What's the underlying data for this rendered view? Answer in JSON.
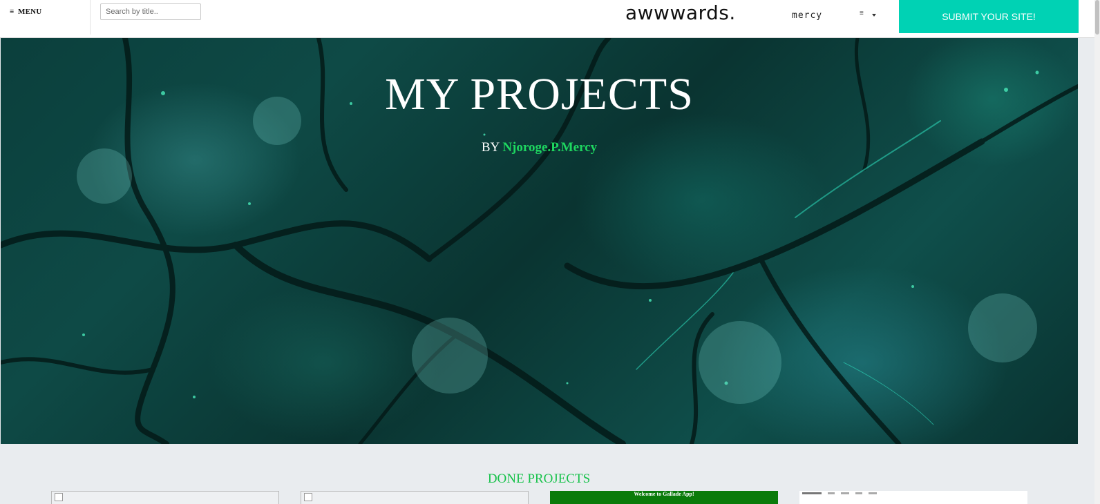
{
  "navbar": {
    "menu_icon": "hamburger-icon",
    "menu_label": "MENU",
    "search_placeholder": "Search by title..",
    "brand": "awwwards.",
    "username": "mercy",
    "dropdown_icon": "hamburger-icon",
    "submit_label": "SUBMIT YOUR SITE!",
    "submit_color": "#00d2b4"
  },
  "hero": {
    "title": "MY PROJECTS",
    "by": "BY",
    "author": "Njoroge.P.Mercy",
    "author_color": "#1ed760"
  },
  "projects": {
    "section_title": "DONE PROJECTS",
    "cards": [
      {
        "type": "broken-image",
        "icon": "broken-image-icon"
      },
      {
        "type": "broken-image",
        "icon": "broken-image-icon"
      },
      {
        "type": "screenshot",
        "caption": "Welcome to Gallade App!",
        "color": "#0a7b0a"
      },
      {
        "type": "screenshot",
        "caption": ""
      }
    ]
  }
}
